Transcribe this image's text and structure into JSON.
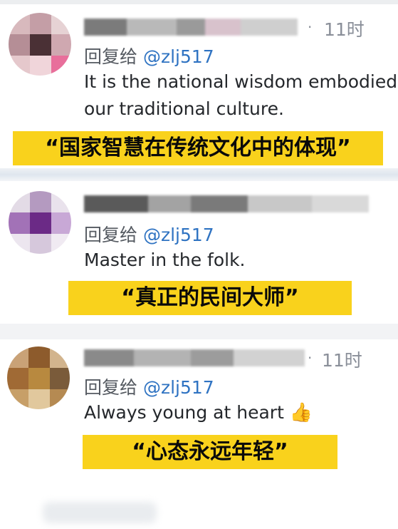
{
  "comments": [
    {
      "time": "11时",
      "reply_prefix": "回复给",
      "reply_handle": "@zlj517",
      "text_line1": "It is the national wisdom embodied",
      "text_line2": "our traditional culture.",
      "caption": "“国家智慧在传统文化中的体现”"
    },
    {
      "reply_prefix": "回复给",
      "reply_handle": "@zlj517",
      "text": "Master in the folk.",
      "caption": "“真正的民间大师”"
    },
    {
      "time": "11时",
      "reply_prefix": "回复给",
      "reply_handle": "@zlj517",
      "text": "Always young at heart",
      "caption": "“心态永远年轻”"
    }
  ],
  "icons": {
    "more": "more-dots-icon",
    "thumbs_up": "thumbs-up-icon"
  },
  "colors": {
    "caption_bg": "#f9d21c",
    "handle": "#2f73c2",
    "meta_text": "#8a8f99"
  }
}
